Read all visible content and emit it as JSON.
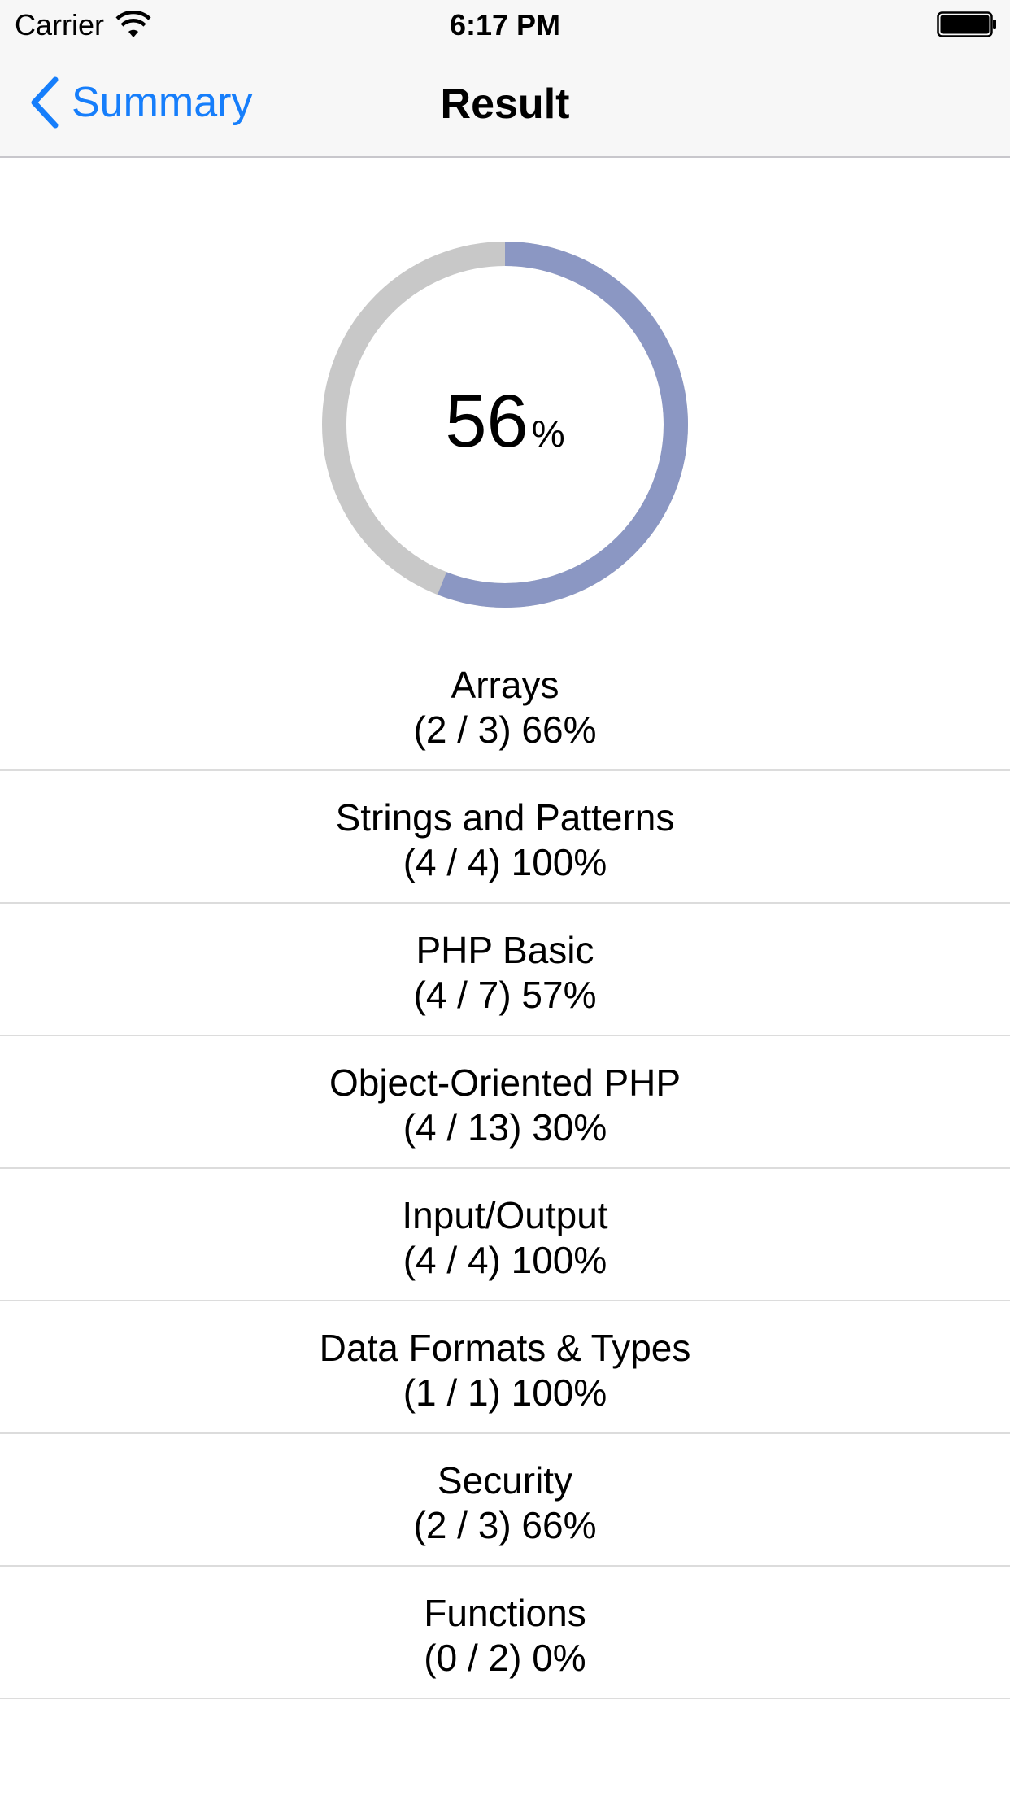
{
  "status_bar": {
    "carrier": "Carrier",
    "time": "6:17 PM",
    "wifi_icon": "wifi-icon",
    "battery_icon": "battery-icon"
  },
  "nav": {
    "back_label": "Summary",
    "back_icon": "chevron-left-icon",
    "title": "Result",
    "accent_color": "#167efb"
  },
  "progress": {
    "percent": 56,
    "value_text": "56",
    "unit": "%",
    "fill_color": "#8b97c3",
    "track_color": "#c8c8c8"
  },
  "categories": [
    {
      "name": "Arrays",
      "score": "(2 / 3) 66%"
    },
    {
      "name": "Strings and Patterns",
      "score": "(4 / 4) 100%"
    },
    {
      "name": "PHP Basic",
      "score": "(4 / 7) 57%"
    },
    {
      "name": "Object-Oriented PHP",
      "score": "(4 / 13) 30%"
    },
    {
      "name": "Input/Output",
      "score": "(4 / 4) 100%"
    },
    {
      "name": "Data Formats & Types",
      "score": "(1 / 1) 100%"
    },
    {
      "name": "Security",
      "score": "(2 / 3) 66%"
    },
    {
      "name": "Functions",
      "score": "(0 / 2) 0%"
    }
  ]
}
